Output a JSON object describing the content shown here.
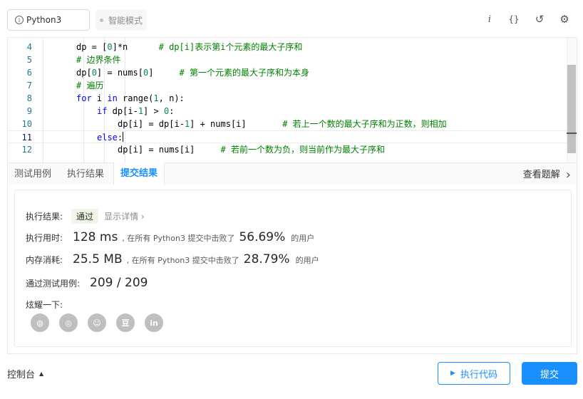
{
  "toolbar": {
    "language": "Python3",
    "smart_mode": "智能模式",
    "icons": [
      "info-italic-icon",
      "braces-icon",
      "reset-icon",
      "settings-icon"
    ],
    "info_glyph": "i",
    "braces_glyph": "{}",
    "reset_glyph": "↺",
    "settings_glyph": "⚙"
  },
  "editor": {
    "current_line": 11,
    "lines": [
      {
        "n": "4",
        "code": "dp = [0]*n      # dp[i]表示第i个元素的最大子序和"
      },
      {
        "n": "5",
        "code": "# 边界条件"
      },
      {
        "n": "6",
        "code": "dp[0] = nums[0]     # 第一个元素的最大子序和为本身"
      },
      {
        "n": "7",
        "code": "# 遍历"
      },
      {
        "n": "8",
        "code": "for i in range(1, n):"
      },
      {
        "n": "9",
        "code": "if dp[i-1] > 0:"
      },
      {
        "n": "10",
        "code": "dp[i] = dp[i-1] + nums[i]       # 若上一个数的最大子序和为正数，则相加"
      },
      {
        "n": "11",
        "code": "else:"
      },
      {
        "n": "12",
        "code": "dp[i] = nums[i]     # 若前一个数为负，则当前作为最大子序和"
      }
    ]
  },
  "tabs": {
    "testcase": "测试用例",
    "run_result": "执行结果",
    "submit_result": "提交结果",
    "view_solution": "查看题解",
    "chevron": "›"
  },
  "result": {
    "status_label": "执行结果:",
    "status": "通过",
    "details_link": "显示详情 ›",
    "runtime_label": "执行用时:",
    "runtime": "128 ms",
    "runtime_text": ", 在所有 Python3 提交中击败了",
    "runtime_pct": "56.69%",
    "runtime_after": "的用户",
    "memory_label": "内存消耗:",
    "memory": "25.5 MB",
    "memory_text": ", 在所有 Python3 提交中击败了",
    "memory_pct": "28.79%",
    "memory_after": "的用户",
    "tests_label": "通过测试用例:",
    "tests": "209 / 209",
    "share_label": "炫耀一下:",
    "share_icons": [
      "wechat-icon",
      "weibo-icon",
      "qq-icon",
      "douban-icon",
      "linkedin-icon"
    ],
    "share_glyphs": {
      "wechat": "◍",
      "weibo": "◎",
      "qq": "☺",
      "douban": "豆",
      "linkedin": "in"
    }
  },
  "bottom": {
    "console": "控制台",
    "console_arrow": "▲",
    "run_code": "执行代码",
    "run_glyph": "▶",
    "submit": "提交"
  },
  "colors": {
    "accent": "#1a90ff",
    "pass_badge_bg": "#f0f7e8",
    "comment": "#008000",
    "keyword": "#0000ff"
  }
}
